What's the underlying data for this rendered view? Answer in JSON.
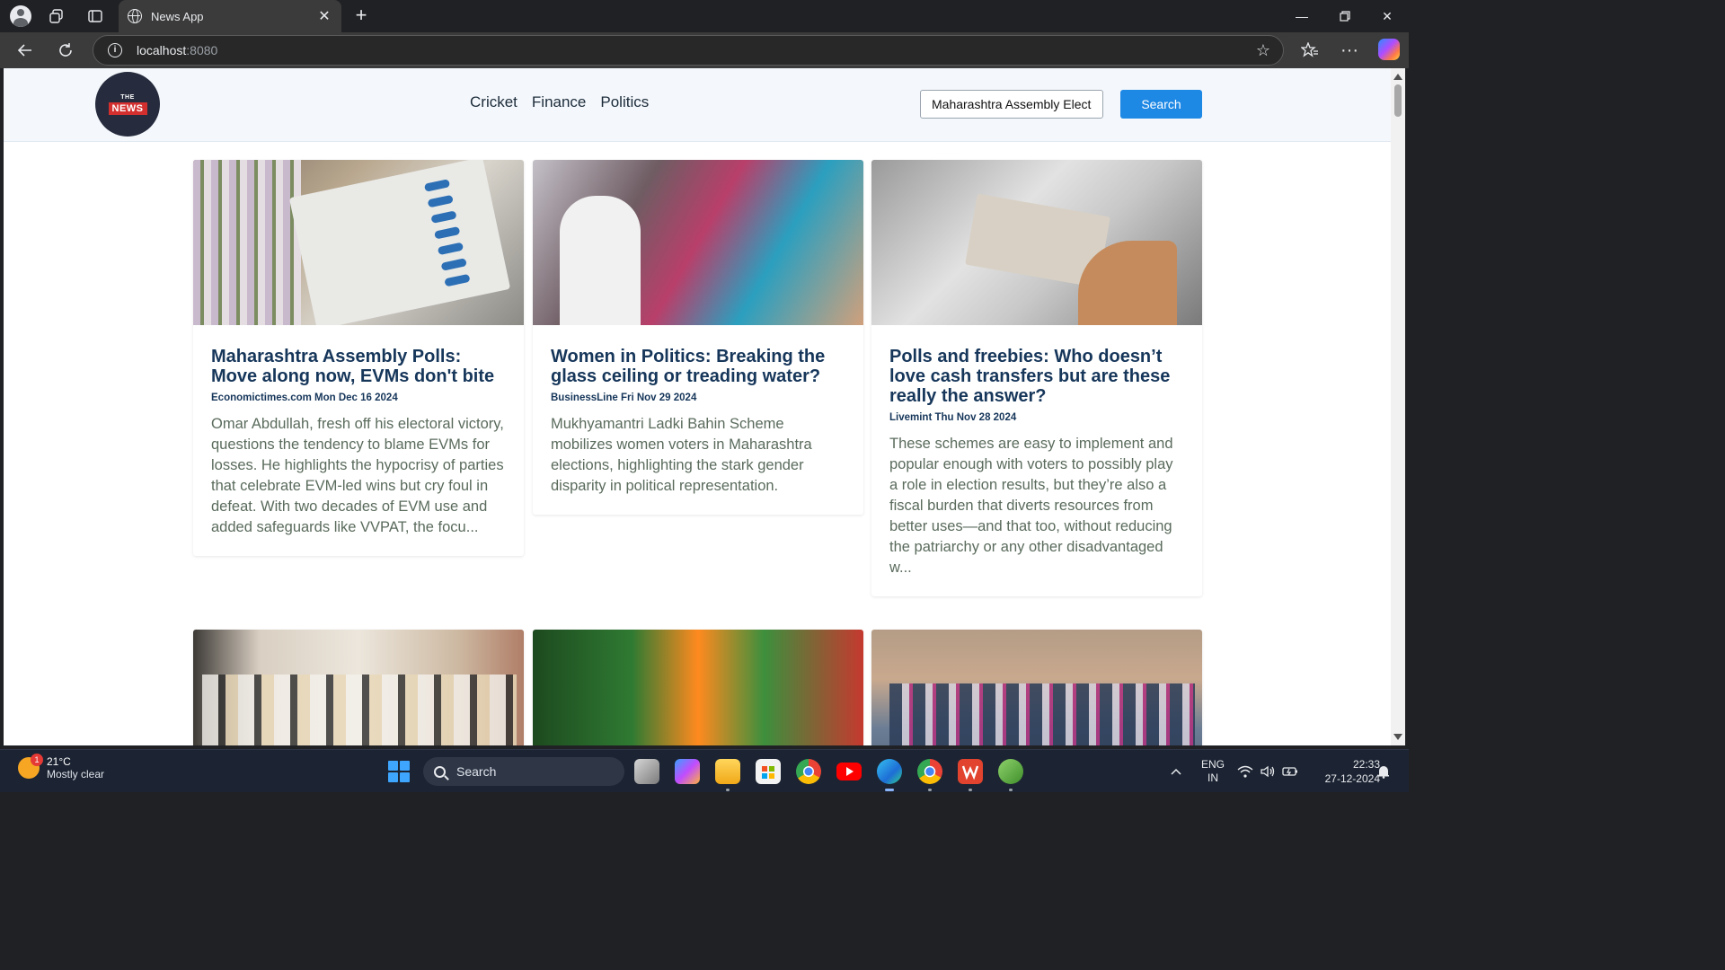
{
  "browser": {
    "tab_title": "News App",
    "url_host": "localhost",
    "url_port": ":8080"
  },
  "site": {
    "logo_top": "THE",
    "logo_bottom": "NEWS",
    "nav": [
      "Cricket",
      "Finance",
      "Politics"
    ],
    "search_value": "Maharashtra Assembly Electi",
    "search_button": "Search"
  },
  "articles": [
    {
      "title": "Maharashtra Assembly Polls: Move along now, EVMs don't bite",
      "meta": "Economictimes.com Mon Dec 16 2024",
      "description": "Omar Abdullah, fresh off his electoral victory, questions the tendency to blame EVMs for losses. He highlights the hypocrisy of parties that celebrate EVM-led wins but cry foul in defeat. With two decades of EVM use and added safeguards like VVPAT, the focu..."
    },
    {
      "title": "Women in Politics: Breaking the glass ceiling or treading water?",
      "meta": "BusinessLine Fri Nov 29 2024",
      "description": "Mukhyamantri Ladki Bahin Scheme mobilizes women voters in Maharashtra elections, highlighting the stark gender disparity in political representation."
    },
    {
      "title": "Polls and freebies: Who doesn’t love cash transfers but are these really the answer?",
      "meta": "Livemint Thu Nov 28 2024",
      "description": "These schemes are easy to implement and popular enough with voters to possibly play a role in election results, but they’re also a fiscal burden that diverts resources from better uses—and that too, without reducing the patriarchy or any other disadvantaged w..."
    }
  ],
  "taskbar": {
    "weather_badge": "1",
    "temperature": "21°C",
    "condition": "Mostly clear",
    "search_label": "Search",
    "lang_top": "ENG",
    "lang_bottom": "IN",
    "time": "22:33",
    "date": "27-12-2024"
  },
  "colors": {
    "accent_blue": "#1e88e5",
    "headline": "#16365a",
    "logo_red": "#d32f2f",
    "logo_bg": "#262c3e"
  }
}
